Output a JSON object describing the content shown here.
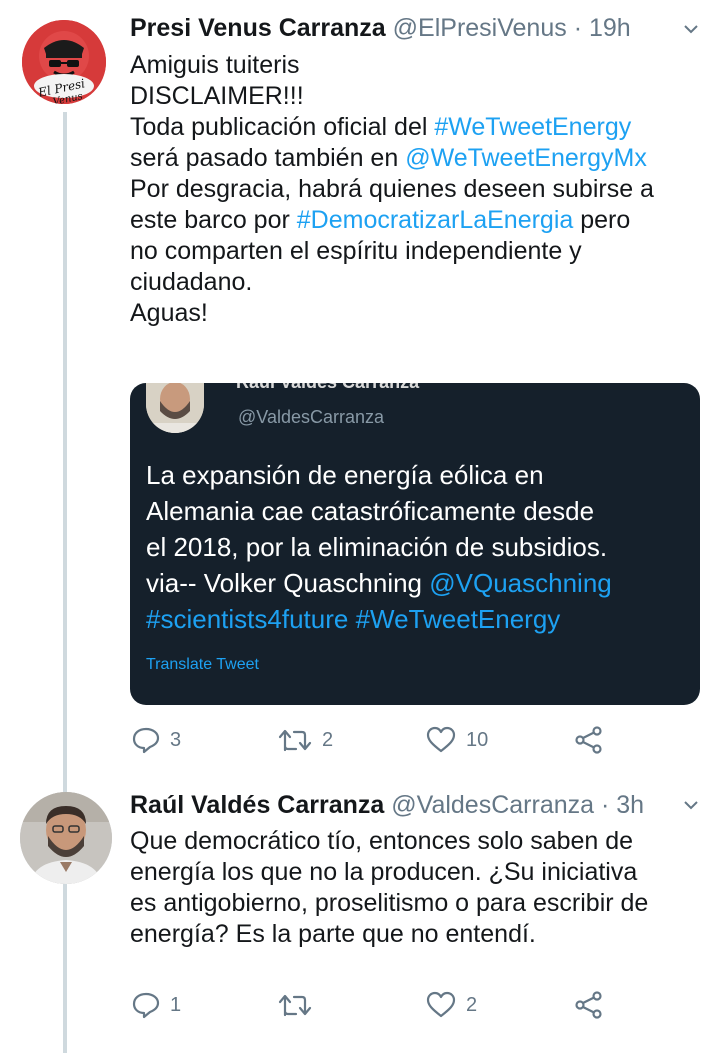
{
  "tweet1": {
    "author_name": "Presi Venus Carranza",
    "handle": "@ElPresiVenus",
    "dot": "·",
    "time": "19h",
    "avatar_text": "El Presi Venus",
    "text_lines": [
      [
        {
          "t": "Amiguis tuiteris",
          "link": false
        }
      ],
      [
        {
          "t": "DISCLAIMER!!!",
          "link": false
        }
      ],
      [
        {
          "t": "Toda publicación oficial del ",
          "link": false
        },
        {
          "t": "#WeTweetEnergy",
          "link": true
        }
      ],
      [
        {
          "t": "será pasado también en ",
          "link": false
        },
        {
          "t": "@WeTweetEnergyMx",
          "link": true
        }
      ],
      [
        {
          "t": "Por desgracia, habrá quienes deseen subirse a",
          "link": false
        }
      ],
      [
        {
          "t": "este barco por ",
          "link": false
        },
        {
          "t": "#DemocratizarLaEnergia",
          "link": true
        },
        {
          "t": " pero",
          "link": false
        }
      ],
      [
        {
          "t": "no comparten el espíritu independiente y",
          "link": false
        }
      ],
      [
        {
          "t": "ciudadano.",
          "link": false
        }
      ],
      [
        {
          "t": "Aguas!",
          "link": false
        }
      ]
    ],
    "embedded": {
      "name_cut": "Raúl Valdés Carranza",
      "handle": "@ValdesCarranza",
      "text_line1": "La expansión de energía eólica en",
      "text_line2": "Alemania cae catastróficamente desde",
      "text_line3": "el 2018, por la eliminación de subsidios.",
      "text_line4_plain": "via-- Volker Quaschning ",
      "text_line4_link": "@VQuaschning",
      "text_line5_link1": "#scientists4future",
      "text_line5_link2": "#WeTweetEnergy",
      "translate": "Translate Tweet"
    },
    "actions": {
      "replies": "3",
      "retweets": "2",
      "likes": "10"
    }
  },
  "tweet2": {
    "author_name": "Raúl Valdés Carranza",
    "handle": "@ValdesCarranza",
    "dot": "·",
    "time": "3h",
    "text_lines": [
      "Que democrático tío, entonces solo saben de",
      "energía los que no la producen. ¿Su iniciativa",
      "es antigobierno, proselitismo o para escribir de",
      "energía? Es la parte que no entendí."
    ],
    "actions": {
      "replies": "1",
      "retweets": "",
      "likes": "2"
    }
  },
  "colors": {
    "link": "#1da1f2",
    "muted": "#657786",
    "embedded_bg": "#15202b"
  }
}
